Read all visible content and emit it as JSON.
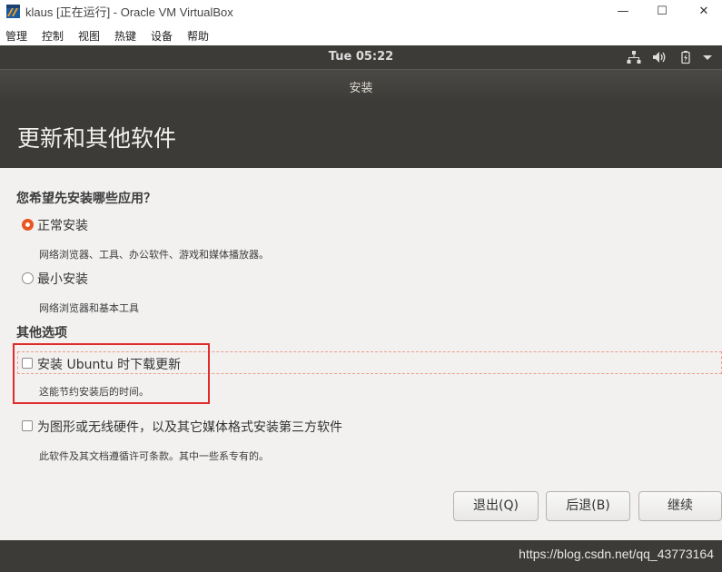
{
  "host_window": {
    "title": "klaus [正在运行] - Oracle VM VirtualBox",
    "icon": "virtualbox-icon",
    "controls": {
      "minimize": "—",
      "maximize": "☐",
      "close": "✕"
    }
  },
  "host_menu": [
    "管理",
    "控制",
    "视图",
    "热键",
    "设备",
    "帮助"
  ],
  "top_panel": {
    "clock": "Tue 05:22",
    "indicators": [
      "network-icon",
      "volume-icon",
      "battery-icon",
      "system-menu-icon"
    ]
  },
  "installer": {
    "window_title": "安装",
    "page_title": "更新和其他软件",
    "question": "您希望先安装哪些应用？",
    "options": [
      {
        "label": "正常安装",
        "description": "网络浏览器、工具、办公软件、游戏和媒体播放器。",
        "selected": true
      },
      {
        "label": "最小安装",
        "description": "网络浏览器和基本工具",
        "selected": false
      }
    ],
    "other_options_heading": "其他选项",
    "checkboxes": [
      {
        "label": "安装 Ubuntu 时下载更新",
        "description": "这能节约安装后的时间。",
        "checked": false
      },
      {
        "label": "为图形或无线硬件，以及其它媒体格式安装第三方软件",
        "description": "此软件及其文档遵循许可条款。其中一些系专有的。",
        "checked": false
      }
    ],
    "buttons": {
      "quit": "退出(Q)",
      "back": "后退(B)",
      "continue": "继续"
    },
    "accent_color": "#e95420"
  },
  "watermark": "https://blog.csdn.net/qq_43773164"
}
